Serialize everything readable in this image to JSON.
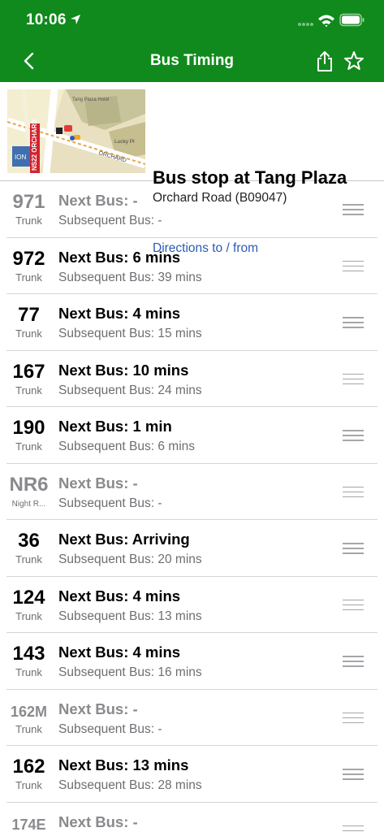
{
  "status_bar": {
    "time": "10:06"
  },
  "navbar": {
    "title": "Bus Timing"
  },
  "stop": {
    "name": "Bus stop at Tang Plaza",
    "road": "Orchard Road (B09047)",
    "directions_link": "Directions to / from",
    "map": {
      "street_label": "ORCHARD",
      "hotel_label": "Tang Plaza Hotel",
      "place_label": "Lucky Pl",
      "station_label": "NS22 ORCHARD",
      "mall_label": "ION"
    }
  },
  "services": [
    {
      "number": "971",
      "type": "Trunk",
      "next": "Next Bus: -",
      "subsequent": "Subsequent Bus: -",
      "active": false
    },
    {
      "number": "972",
      "type": "Trunk",
      "next": "Next Bus: 6 mins",
      "subsequent": "Subsequent Bus: 39 mins",
      "active": true
    },
    {
      "number": "77",
      "type": "Trunk",
      "next": "Next Bus: 4 mins",
      "subsequent": "Subsequent Bus: 15 mins",
      "active": true
    },
    {
      "number": "167",
      "type": "Trunk",
      "next": "Next Bus: 10 mins",
      "subsequent": "Subsequent Bus: 24 mins",
      "active": true
    },
    {
      "number": "190",
      "type": "Trunk",
      "next": "Next Bus: 1 min",
      "subsequent": "Subsequent Bus: 6 mins",
      "active": true
    },
    {
      "number": "NR6",
      "type": "Night R...",
      "next": "Next Bus: -",
      "subsequent": "Subsequent Bus: -",
      "active": false
    },
    {
      "number": "36",
      "type": "Trunk",
      "next": "Next Bus: Arriving",
      "subsequent": "Subsequent Bus: 20 mins",
      "active": true
    },
    {
      "number": "124",
      "type": "Trunk",
      "next": "Next Bus: 4 mins",
      "subsequent": "Subsequent Bus: 13 mins",
      "active": true
    },
    {
      "number": "143",
      "type": "Trunk",
      "next": "Next Bus: 4 mins",
      "subsequent": "Subsequent Bus: 16 mins",
      "active": true
    },
    {
      "number": "162M",
      "type": "Trunk",
      "next": "Next Bus: -",
      "subsequent": "Subsequent Bus: -",
      "active": false
    },
    {
      "number": "162",
      "type": "Trunk",
      "next": "Next Bus: 13 mins",
      "subsequent": "Subsequent Bus: 28 mins",
      "active": true
    },
    {
      "number": "174E",
      "type": "",
      "next": "Next Bus: -",
      "subsequent": "",
      "active": false
    }
  ],
  "colors": {
    "header_green": "#108a1c",
    "link_blue": "#2a5bb5",
    "inactive_grey": "#8a8a8e"
  },
  "icons": {
    "back": "chevron-left-icon",
    "share": "share-icon",
    "favorite": "star-outline-icon",
    "reorder": "drag-handle-icon"
  }
}
